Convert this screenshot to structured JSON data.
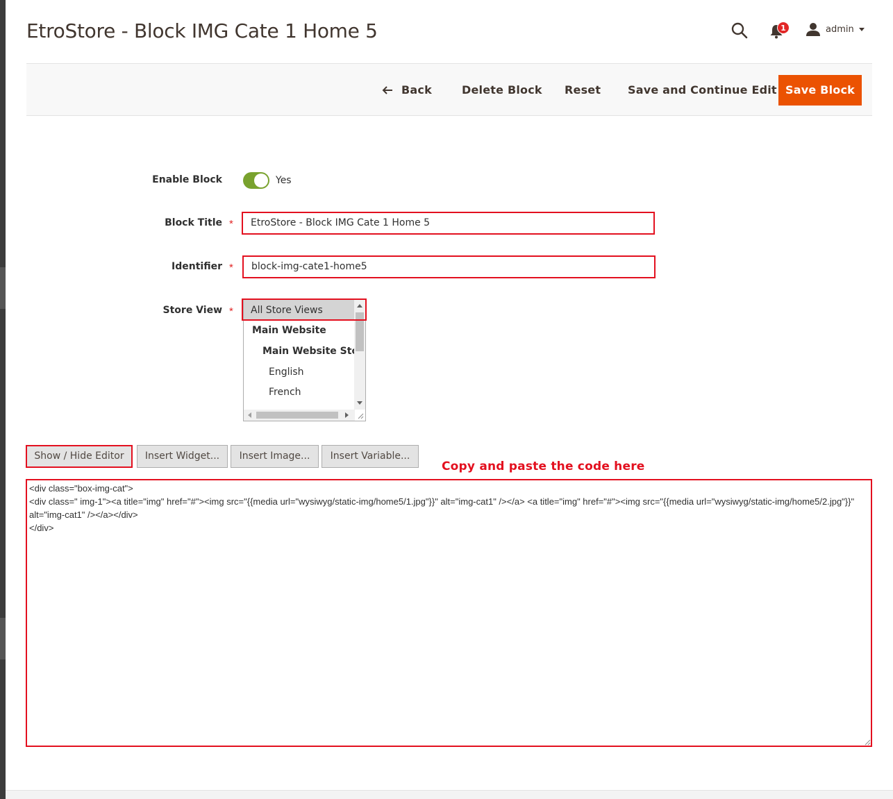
{
  "header": {
    "title": "EtroStore - Block IMG Cate 1 Home 5",
    "notifications_count": "1",
    "user_name": "admin"
  },
  "actions": {
    "back": "Back",
    "delete": "Delete Block",
    "reset": "Reset",
    "save_continue": "Save and Continue Edit",
    "save": "Save Block"
  },
  "form": {
    "enable_block": {
      "label": "Enable Block",
      "value": "Yes",
      "enabled": true
    },
    "block_title": {
      "label": "Block Title",
      "value": "EtroStore - Block IMG Cate 1 Home 5"
    },
    "identifier": {
      "label": "Identifier",
      "value": "block-img-cate1-home5"
    },
    "store_view": {
      "label": "Store View",
      "options": [
        "All Store Views",
        "Main Website",
        "Main Website Store",
        "English",
        "French"
      ],
      "selected": "All Store Views"
    },
    "required_mark": "*"
  },
  "editor": {
    "buttons": {
      "show_hide": "Show / Hide Editor",
      "insert_widget": "Insert Widget...",
      "insert_image": "Insert Image...",
      "insert_variable": "Insert Variable..."
    },
    "annotation": "Copy and paste the code here",
    "content": "<div class=\"box-img-cat\">\n<div class=\" img-1\"><a title=\"img\" href=\"#\"><img src=\"{{media url=\"wysiwyg/static-img/home5/1.jpg\"}}\" alt=\"img-cat1\" /></a> <a title=\"img\" href=\"#\"><img src=\"{{media url=\"wysiwyg/static-img/home5/2.jpg\"}}\" alt=\"img-cat1\" /></a></div>\n</div>"
  },
  "colors": {
    "accent": "#eb5202",
    "highlight": "#e3101f",
    "toggle_on": "#79a22e",
    "badge": "#e22626"
  },
  "icons": [
    "search-icon",
    "bell-icon",
    "user-icon",
    "arrow-left-icon"
  ]
}
